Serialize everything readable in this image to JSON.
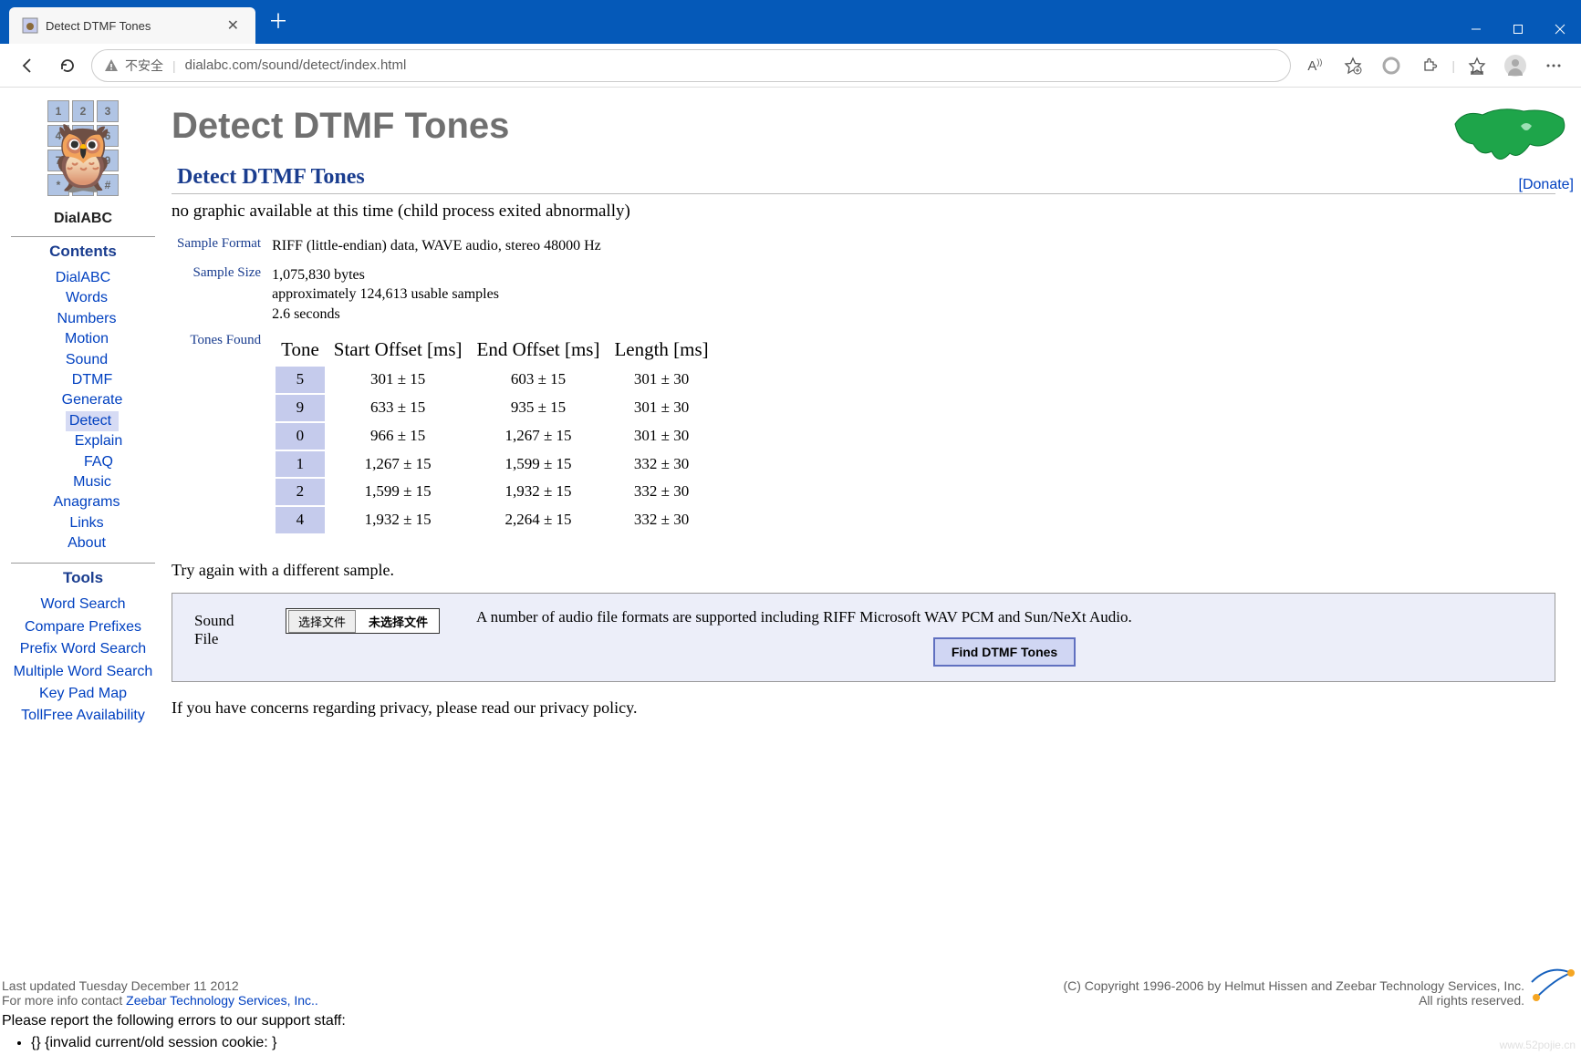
{
  "browser": {
    "tab_title": "Detect DTMF Tones",
    "insecure_label": "不安全",
    "url": "dialabc.com/sound/detect/index.html"
  },
  "sidebar": {
    "logo_text": "DialABC",
    "contents_header": "Contents",
    "tools_header": "Tools",
    "nav": {
      "dialabc": "DialABC",
      "words": "Words",
      "numbers": "Numbers",
      "motion": "Motion",
      "sound": "Sound",
      "dtmf": "DTMF",
      "generate": "Generate",
      "detect": "Detect",
      "explain": "Explain",
      "faq": "FAQ",
      "music": "Music",
      "anagrams": "Anagrams",
      "links": "Links",
      "about": "About"
    },
    "tools": {
      "word_search": "Word Search",
      "compare_prefixes": "Compare Prefixes",
      "prefix_word_search": "Prefix Word Search",
      "multiple_word_search": "Multiple Word Search",
      "key_pad_map": "Key Pad Map",
      "tollfree": "TollFree Availability"
    }
  },
  "main": {
    "h1": "Detect DTMF Tones",
    "donate": "[Donate]",
    "h2": "Detect DTMF Tones",
    "error_msg": "no graphic available at this time (child process exited abnormally)",
    "labels": {
      "sample_format": "Sample Format",
      "sample_size": "Sample Size",
      "tones_found": "Tones Found"
    },
    "sample_format_val": "RIFF (little-endian) data, WAVE audio, stereo 48000 Hz",
    "sample_size_lines": {
      "l1": "1,075,830 bytes",
      "l2": "approximately 124,613 usable samples",
      "l3": "2.6 seconds"
    },
    "tones_headers": {
      "tone": "Tone",
      "start": "Start Offset [ms]",
      "end": "End Offset [ms]",
      "length": "Length [ms]"
    },
    "tones": [
      {
        "tone": "5",
        "start": "301 ± 15",
        "end": "603 ± 15",
        "length": "301 ± 30"
      },
      {
        "tone": "9",
        "start": "633 ± 15",
        "end": "935 ± 15",
        "length": "301 ± 30"
      },
      {
        "tone": "0",
        "start": "966 ± 15",
        "end": "1,267 ± 15",
        "length": "301 ± 30"
      },
      {
        "tone": "1",
        "start": "1,267 ± 15",
        "end": "1,599 ± 15",
        "length": "332 ± 30"
      },
      {
        "tone": "2",
        "start": "1,599 ± 15",
        "end": "1,932 ± 15",
        "length": "332 ± 30"
      },
      {
        "tone": "4",
        "start": "1,932 ± 15",
        "end": "2,264 ± 15",
        "length": "332 ± 30"
      }
    ],
    "try_again": "Try again with a different sample.",
    "form": {
      "label": "Sound File",
      "choose_btn": "选择文件",
      "no_file": "未选择文件",
      "help": "A number of audio file formats are supported including RIFF Microsoft WAV PCM and Sun/NeXt Audio.",
      "submit": "Find DTMF Tones"
    },
    "privacy": "If you have concerns regarding privacy, please read our privacy policy."
  },
  "footer": {
    "updated": "Last updated Tuesday December 11 2012",
    "moreinfo_prefix": "For more info contact ",
    "moreinfo_link": "Zeebar Technology Services, Inc..",
    "copyright": "(C) Copyright 1996-2006 by Helmut Hissen and Zeebar Technology Services, Inc.",
    "rights": "All rights reserved.",
    "err_header": "Please report the following errors to our support staff:",
    "err1": "{} {invalid current/old session cookie: }"
  }
}
